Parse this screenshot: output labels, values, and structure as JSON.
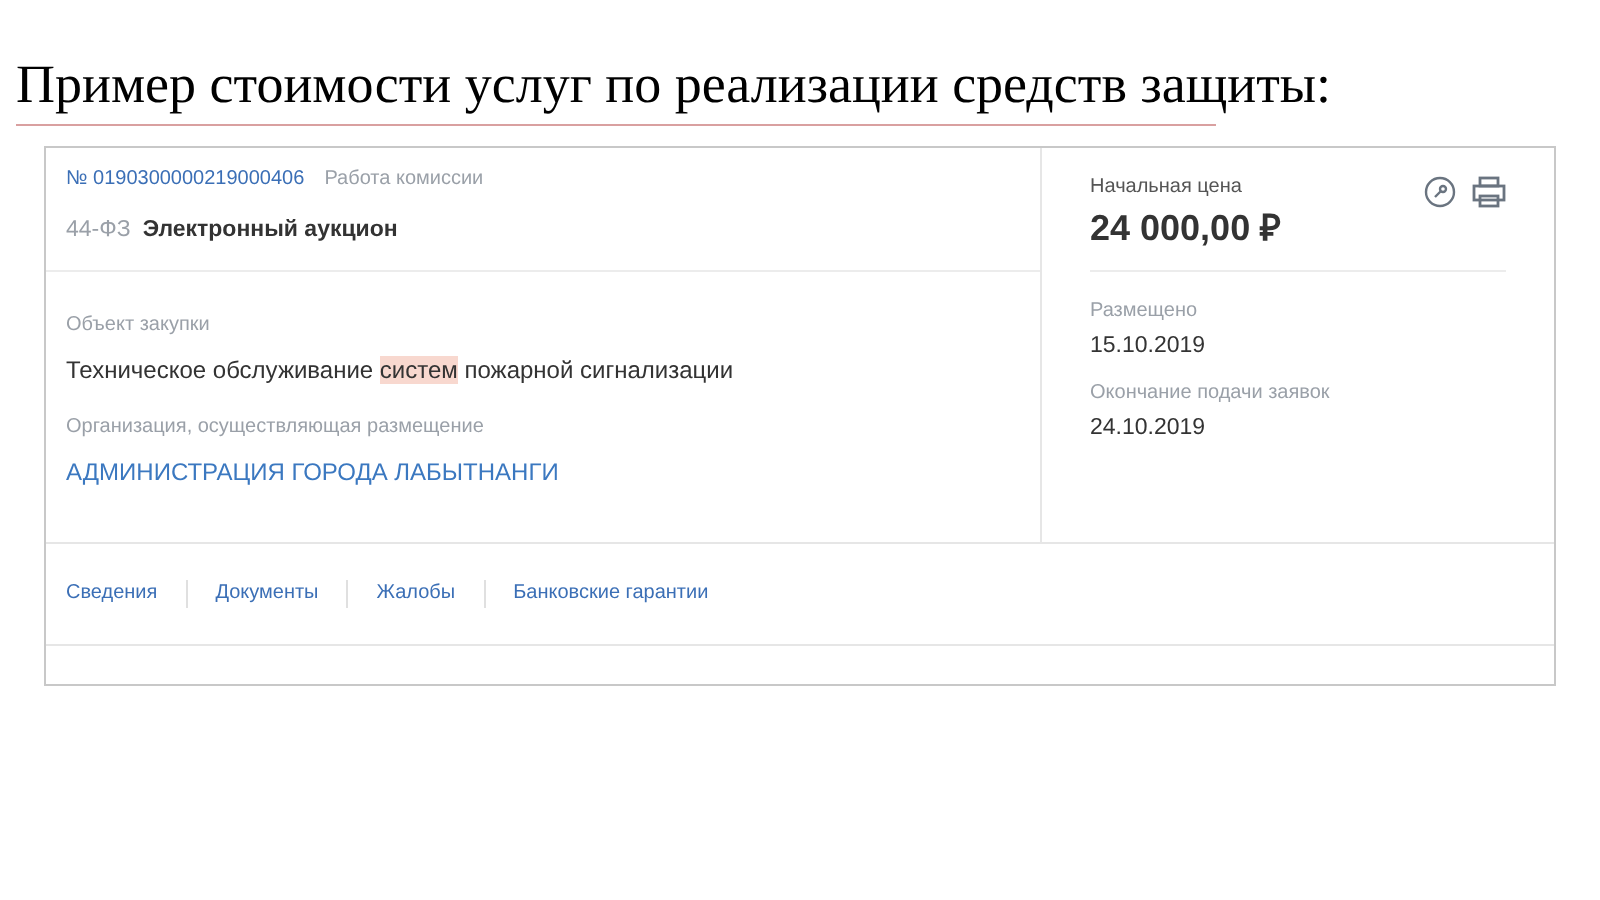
{
  "slide_title": "Пример стоимости услуг по реализации средств защиты:",
  "card": {
    "number": "№ 0190300000219000406",
    "stage": "Работа комиссии",
    "law": "44-ФЗ",
    "method": "Электронный аукцион",
    "subject_label": "Объект закупки",
    "subject": [
      {
        "text": "Техническое обслуживание ",
        "highlighted": false
      },
      {
        "text": "систем",
        "highlighted": true
      },
      {
        "text": " пожарной сигнализации",
        "highlighted": false
      }
    ],
    "org_label": "Организация, осуществляющая размещение",
    "org": "АДМИНИСТРАЦИЯ ГОРОДА ЛАБЫТНАНГИ",
    "price_label": "Начальная цена",
    "price": "24 000,00 ₽",
    "dates": [
      {
        "label": "Размещено",
        "value": "15.10.2019"
      },
      {
        "label": "Окончание подачи заявок",
        "value": "24.10.2019"
      }
    ],
    "links": [
      "Сведения",
      "Документы",
      "Жалобы",
      "Банковские гарантии"
    ]
  }
}
